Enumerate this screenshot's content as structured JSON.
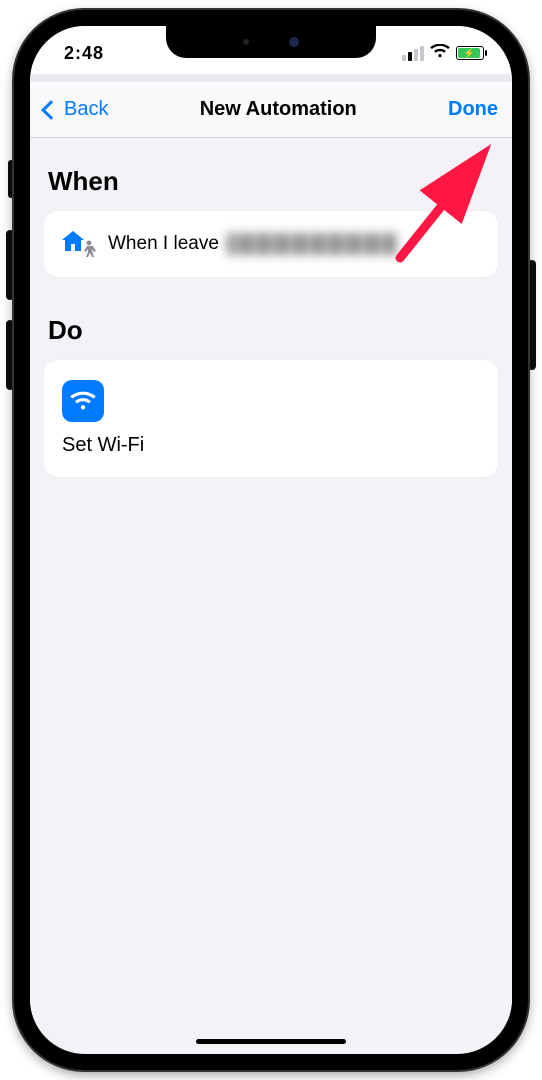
{
  "statusbar": {
    "time": "2:48"
  },
  "nav": {
    "back": "Back",
    "title": "New Automation",
    "done": "Done"
  },
  "sections": {
    "when": {
      "header": "When",
      "prefix": "When I leave",
      "location": "[redacted]"
    },
    "do": {
      "header": "Do",
      "action_label": "Set Wi-Fi"
    }
  }
}
